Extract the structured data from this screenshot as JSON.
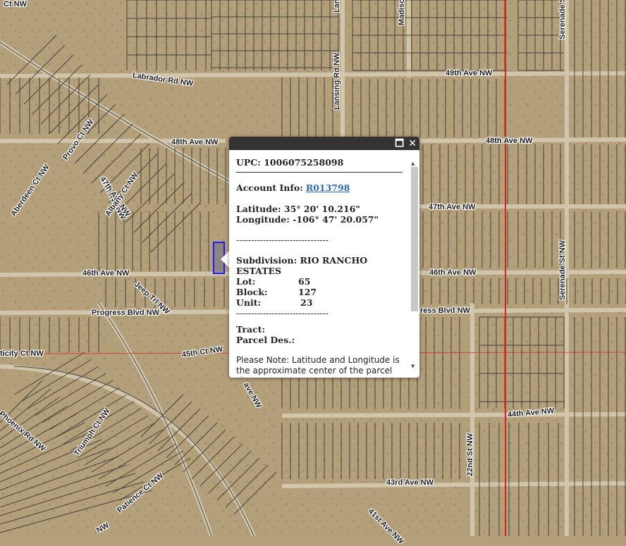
{
  "roads": [
    {
      "id": "labrador",
      "text": "Labrador Rd NW"
    },
    {
      "id": "ave49",
      "text": "49th Ave NW"
    },
    {
      "id": "ave48w",
      "text": "48th Ave NW"
    },
    {
      "id": "ave48e",
      "text": "48th Ave NW"
    },
    {
      "id": "ave47e",
      "text": "47th Ave NW"
    },
    {
      "id": "ave47w",
      "text": "47th Ave NW"
    },
    {
      "id": "ave46w",
      "text": "46th Ave NW"
    },
    {
      "id": "ave46e",
      "text": "46th Ave NW"
    },
    {
      "id": "progress_w",
      "text": "Progress Blvd NW"
    },
    {
      "id": "progress_e",
      "text": "ress Blvd NW"
    },
    {
      "id": "ct45",
      "text": "45th Ct NW"
    },
    {
      "id": "ave44",
      "text": "44th Ave NW"
    },
    {
      "id": "ave43",
      "text": "43rd Ave NW"
    },
    {
      "id": "lansing1",
      "text": "Lansing Ct NW"
    },
    {
      "id": "lansing2",
      "text": "Lansing Rd NW"
    },
    {
      "id": "madison",
      "text": "Madison Ct NW"
    },
    {
      "id": "serenade_ct",
      "text": "Serenade St NW"
    },
    {
      "id": "serenade_st",
      "text": "Serenade St NW"
    },
    {
      "id": "provo",
      "text": "Provo Ct NW"
    },
    {
      "id": "ave47n",
      "text": "47th Ave NW"
    },
    {
      "id": "aberdeen",
      "text": "Aberdeen Ct NW"
    },
    {
      "id": "albany",
      "text": "Albany Ct NW"
    },
    {
      "id": "jeep",
      "text": "Jeep Trl NW"
    },
    {
      "id": "ticity",
      "text": "ticity Ct NW"
    },
    {
      "id": "phoenix",
      "text": "Phoenix Rd NW"
    },
    {
      "id": "triumph",
      "text": "Triumph Ct NW"
    },
    {
      "id": "patience",
      "text": "Patience Ct NW"
    },
    {
      "id": "st22",
      "text": "22nd St NW"
    },
    {
      "id": "ave41",
      "text": "41st Ave NW"
    },
    {
      "id": "ctnw_top",
      "text": "Ct NW"
    },
    {
      "id": "ave_nw",
      "text": "ave NW"
    },
    {
      "id": "nw_bottom",
      "text": "NW"
    }
  ],
  "popup": {
    "upc": "UPC: 1006075258098",
    "account_label": "Account Info:",
    "account_link": "R013798",
    "latitude": "Latitude: 35° 20' 10.216\"",
    "longitude": "Longitude: -106° 47' 20.057\"",
    "dashes1": "-------------------------------",
    "subdivision": "Subdivision: RIO RANCHO ESTATES",
    "lot_label": "Lot:",
    "lot_value": "65",
    "block_label": "Block:",
    "block_value": "127",
    "unit_label": "Unit:",
    "unit_value": "23",
    "dashes2": "-------------------------------",
    "tract": "Tract:",
    "parcel_des": "Parcel Des.:",
    "note": "Please Note: Latitude and Longitude is the approximate center of the parcel shown."
  },
  "controls": {
    "maximize": "🗖",
    "close": "✕"
  },
  "colors": {
    "boundary": "#e0201c",
    "parcel_line": "#2a2a2a",
    "highlight": "#1c1cf0",
    "desert": "#b39f7a"
  }
}
